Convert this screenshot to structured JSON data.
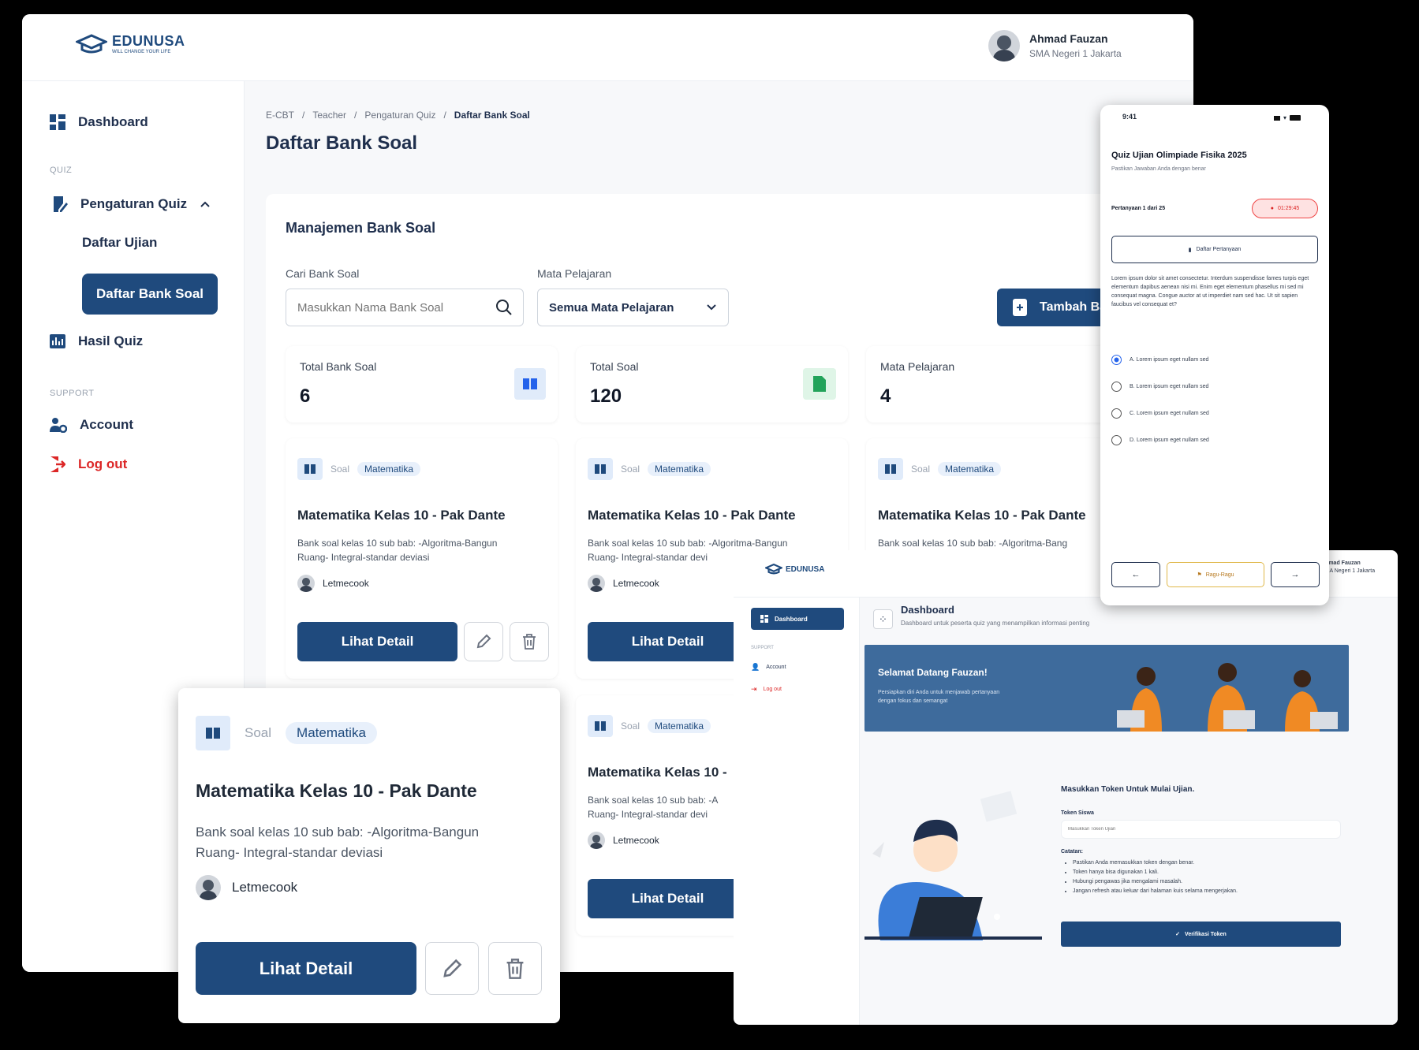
{
  "app": {
    "logo_name": "EDUNUSA",
    "logo_tagline": "WILL CHANGE YOUR LIFE"
  },
  "user": {
    "name": "Ahmad Fauzan",
    "school": "SMA Negeri 1 Jakarta"
  },
  "sidebar": {
    "dashboard": "Dashboard",
    "section_quiz": "QUIZ",
    "pengaturan_quiz": "Pengaturan Quiz",
    "daftar_ujian": "Daftar Ujian",
    "daftar_bank_soal": "Daftar Bank Soal",
    "hasil_quiz": "Hasil Quiz",
    "section_support": "SUPPORT",
    "account": "Account",
    "logout": "Log out"
  },
  "breadcrumb": {
    "items": [
      "E-CBT",
      "Teacher",
      "Pengaturan Quiz"
    ],
    "current": "Daftar Bank Soal"
  },
  "page": {
    "title": "Daftar Bank Soal"
  },
  "panel": {
    "title": "Manajemen Bank Soal",
    "search_label": "Cari Bank Soal",
    "search_placeholder": "Masukkan Nama Bank Soal",
    "subject_label": "Mata Pelajaran",
    "subject_value": "Semua Mata Pelajaran",
    "add_button": "Tambah Bank"
  },
  "stats": [
    {
      "label": "Total Bank Soal",
      "value": "6"
    },
    {
      "label": "Total Soal",
      "value": "120"
    },
    {
      "label": "Mata Pelajaran",
      "value": "4"
    }
  ],
  "bank_card": {
    "type_label": "Soal",
    "subject": "Matematika",
    "title": "Matematika Kelas 10 - Pak Dante",
    "title_short": "Matematika Kelas 10 -",
    "desc": "Bank soal kelas 10 sub bab: -Algoritma-Bangun Ruang- Integral-standar deviasi",
    "desc_line1": "Bank soal kelas 10 sub bab: -Algoritma-Bangun",
    "desc_line2": "Ruang- Integral-standar deviasi",
    "desc_line1b": "Bank soal kelas 10 sub bab: -Algoritma-Bang",
    "desc_line2b": "Ruang- Integral-standar devi",
    "desc_line1c": "Bank soal kelas 10 sub bab: -A",
    "desc_line2c": "Ruang- Integral-standar devi",
    "author": "Letmecook",
    "detail_button": "Lihat Detail"
  },
  "phone": {
    "time": "9:41",
    "quiz_title": "Quiz Ujian Olimpiade Fisika 2025",
    "quiz_sub": "Pastikan Jawaban Anda dengan benar",
    "progress": "Pertanyaan 1 dari 25",
    "timer": "01:29:45",
    "list_button": "Daftar Pertanyaan",
    "question": "Lorem ipsum dolor sit amet consectetur. Interdum suspendisse fames turpis eget elementum dapibus aenean nisi mi. Enim eget elementum phasellus mi sed mi consequat magna. Congue auctor at ut imperdiet nam sed hac. Ut sit sapien faucibus vel consequat et?",
    "options": [
      "A. Lorem ipsum eget nullam sed",
      "B. Lorem ipsum eget nullam sed",
      "C. Lorem ipsum eget nullam sed",
      "D. Lorem ipsum eget nullam sed"
    ],
    "flag_button": "Ragu-Ragu",
    "prev": "←",
    "next": "→"
  },
  "student": {
    "user_name": "Ahmad Fauzan",
    "user_sub": "SMA Negeri 1 Jakarta",
    "nav_dashboard": "Dashboard",
    "nav_section": "SUPPORT",
    "nav_account": "Account",
    "nav_logout": "Log out",
    "title": "Dashboard",
    "subtitle": "Dashboard untuk peserta quiz yang menampilkan informasi penting",
    "welcome_title": "Selamat Datang Fauzan!",
    "welcome_l1": "Persiapkan diri Anda untuk menjawab pertanyaan",
    "welcome_l2": "dengan fokus dan semangat",
    "token_title": "Masukkan Token Untuk Mulai Ujian.",
    "token_label": "Token Siswa",
    "token_placeholder": "Masukkan Token Ujian",
    "notes_label": "Catatan:",
    "notes": [
      "Pastikan Anda memasukkan token dengan benar.",
      "Token hanya bisa digunakan 1 kali.",
      "Hubungi pengawas jika mengalami masalah.",
      "Jangan refresh atau keluar dari halaman kuis selama mengerjakan."
    ],
    "verify_button": "Verifikasi Token"
  },
  "colors": {
    "primary": "#1f4a7d",
    "danger": "#dc2626",
    "pill_bg": "#e8f0fb",
    "orange": "#f08a24"
  }
}
